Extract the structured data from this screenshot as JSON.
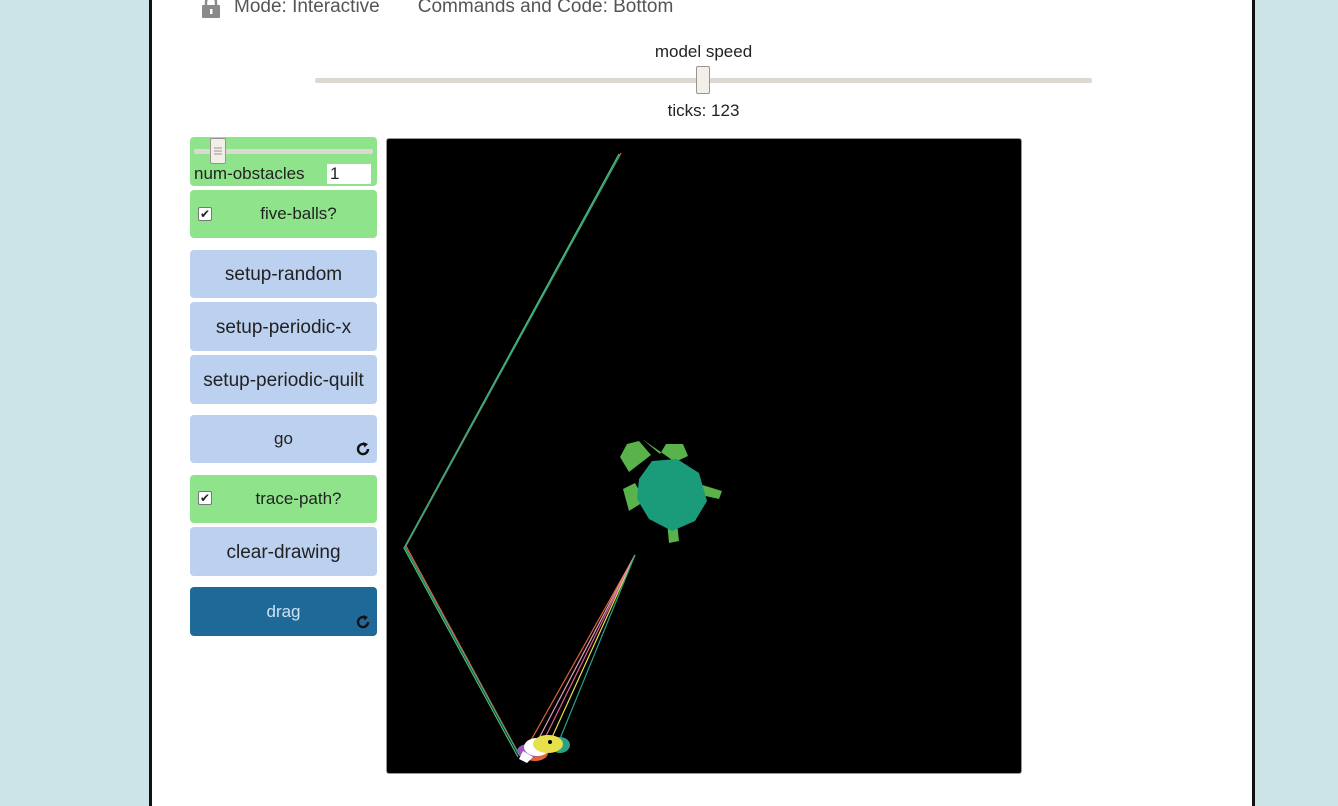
{
  "header": {
    "mode_label": "Mode: Interactive",
    "commands_label": "Commands and Code: Bottom"
  },
  "speed": {
    "label": "model speed",
    "ticks_label": "ticks: 123",
    "value": 0.5
  },
  "widgets": {
    "num_obstacles": {
      "label": "num-obstacles",
      "value": "1"
    },
    "five_balls": {
      "label": "five-balls?",
      "checked": true
    },
    "setup_random": {
      "label": "setup-random"
    },
    "setup_periodic_x": {
      "label": "setup-periodic-x"
    },
    "setup_periodic_quilt": {
      "label": "setup-periodic-quilt"
    },
    "go": {
      "label": "go"
    },
    "trace_path": {
      "label": "trace-path?",
      "checked": true
    },
    "clear_drawing": {
      "label": "clear-drawing"
    },
    "drag": {
      "label": "drag"
    }
  },
  "colors": {
    "background": "#cce3e8",
    "widget_green": "#8fe38a",
    "widget_blue": "#bcd0ef",
    "widget_dark": "#1e6997",
    "view_background": "#000000",
    "turtle_shell": "#1a9c7a",
    "turtle_limbs": "#5ab34a"
  }
}
